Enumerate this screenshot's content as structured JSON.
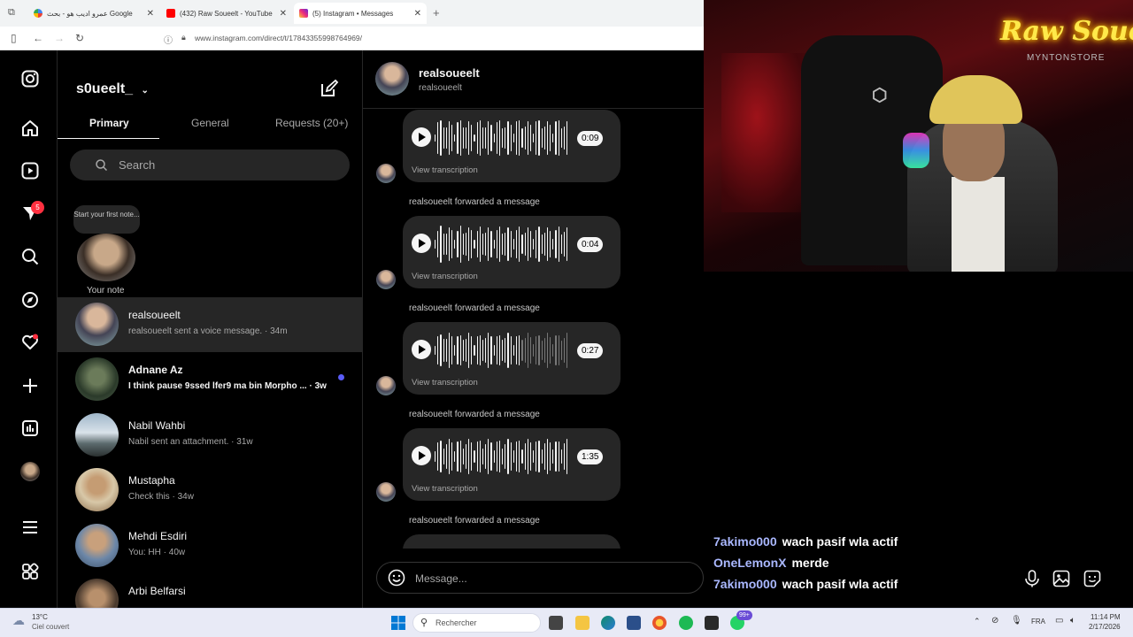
{
  "browser": {
    "tabs": [
      {
        "label": "عمرو اديب هو - بحث Google",
        "close": "✕",
        "active": false
      },
      {
        "label": "(432) Raw Soueelt - YouTube",
        "close": "✕",
        "active": false
      },
      {
        "label": "(5) Instagram • Messages",
        "close": "✕",
        "active": true
      }
    ],
    "new_tab": "+",
    "url": "www.instagram.com/direct/t/17843355998764969/"
  },
  "instagram": {
    "rail": {
      "notifications_badge": "5"
    },
    "username": "s0ueelt_",
    "tabs": [
      "Primary",
      "General",
      "Requests (20+)"
    ],
    "search_placeholder": "Search",
    "note": {
      "bubble": "Start your first note...",
      "label": "Your note"
    },
    "threads": [
      {
        "name": "realsoueelt",
        "preview": "realsoueelt sent a voice message. · 34m",
        "selected": true,
        "unread": false
      },
      {
        "name": "Adnane Az",
        "preview": "I think pause 9ssed lfer9 ma bin Morpho ... · 3w",
        "selected": false,
        "unread": true
      },
      {
        "name": "Nabil Wahbi",
        "preview": "Nabil sent an attachment. · 31w",
        "selected": false,
        "unread": false
      },
      {
        "name": "Mustapha",
        "preview": "Check this · 34w",
        "selected": false,
        "unread": false
      },
      {
        "name": "Mehdi Esdiri",
        "preview": "You: HH · 40w",
        "selected": false,
        "unread": false
      },
      {
        "name": "Arbi Belfarsi",
        "preview": "",
        "selected": false,
        "unread": false
      }
    ],
    "conversation": {
      "name": "realsoueelt",
      "subtitle": "realsoueelt",
      "forwarded_label": "realsoueelt forwarded a message",
      "transcription_label": "View transcription",
      "voice_messages": [
        {
          "duration": "0:09"
        },
        {
          "duration": "0:04"
        },
        {
          "duration": "0:27"
        },
        {
          "duration": "1:35"
        }
      ],
      "message_placeholder": "Message..."
    }
  },
  "stream": {
    "neon_sign": "Raw Soueelt",
    "neon_sub": "MYNTONSTORE",
    "chat": [
      {
        "user": "7akimo000",
        "message": "wach pasif wla actif"
      },
      {
        "user": "OneLemonX",
        "message": "merde"
      },
      {
        "user": "7akimo000",
        "message": "wach pasif wla actif"
      }
    ]
  },
  "taskbar": {
    "weather_temp": "13°C",
    "weather_desc": "Ciel couvert",
    "search_placeholder": "Rechercher",
    "whatsapp_badge": "99+",
    "language": "FRA",
    "time": "11:14 PM",
    "date": "2/17/2026"
  },
  "colors": {
    "accent_blue": "#5a5cf7",
    "badge_red": "#ff3040",
    "chat_user": "#aab8ff",
    "neon_yellow": "#ffe94a"
  }
}
